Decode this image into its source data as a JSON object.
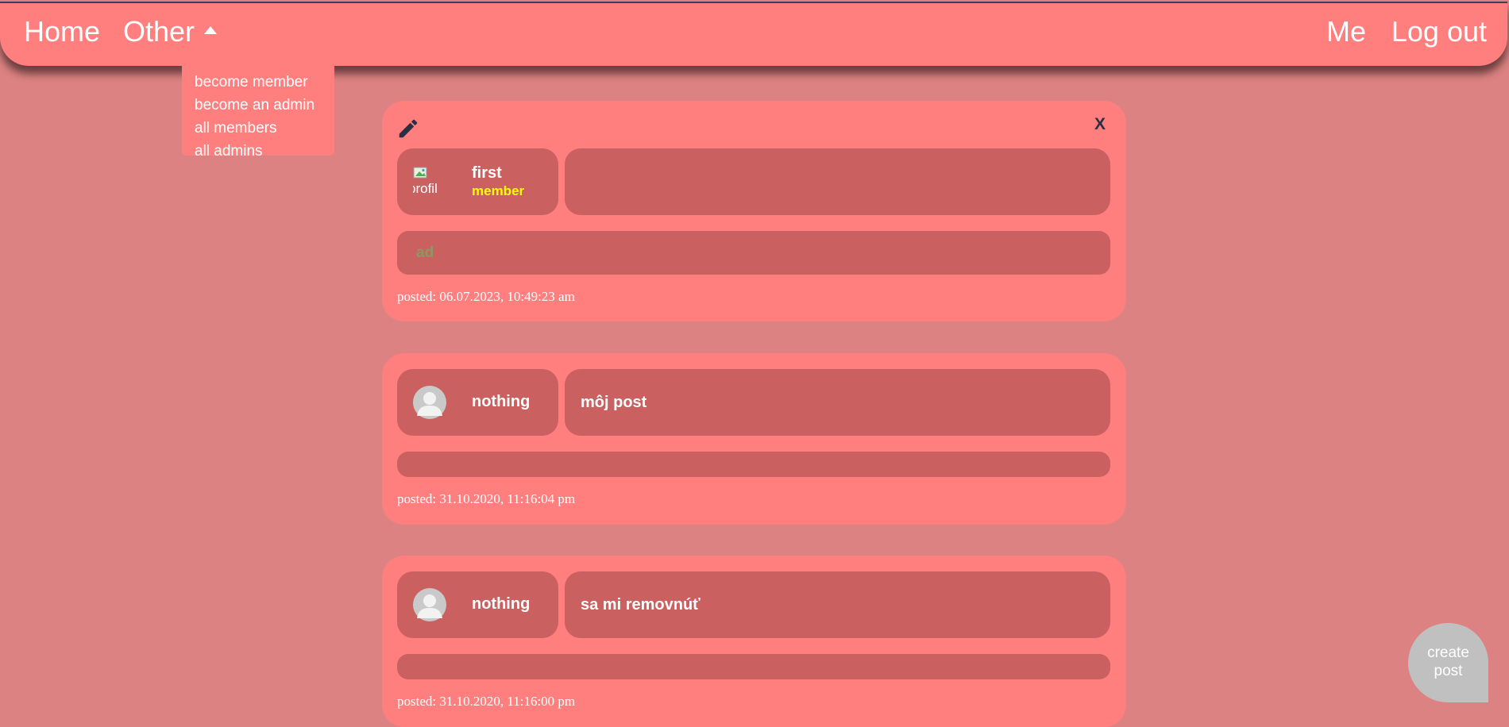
{
  "nav": {
    "home": "Home",
    "other": "Other",
    "me": "Me",
    "logout": "Log out"
  },
  "dropdown": {
    "items": [
      "become member",
      "become an admin",
      "all members",
      "all admins"
    ]
  },
  "posts": [
    {
      "author": "first",
      "role": "member",
      "avatar_alt": "profil",
      "title": "",
      "content": "ad",
      "posted": "posted: 06.07.2023, 10:49:23 am",
      "editable": true,
      "edit_icon": "pencil-icon",
      "close_label": "X"
    },
    {
      "author": "nothing",
      "title": "môj post",
      "content": "",
      "posted": "posted: 31.10.2020, 11:16:04 pm"
    },
    {
      "author": "nothing",
      "title": "sa mi removnúť",
      "content": "",
      "posted": "posted: 31.10.2020, 11:16:00 pm"
    }
  ],
  "create_post": {
    "line1": "create",
    "line2": "post"
  },
  "colors": {
    "page_background": "#dc8282",
    "navbar": "#ff7f7f",
    "card": "#ff7f7f",
    "inner_box": "#cb6060",
    "role_badge": "#ffff00",
    "create_button": "#c0c0c0"
  }
}
